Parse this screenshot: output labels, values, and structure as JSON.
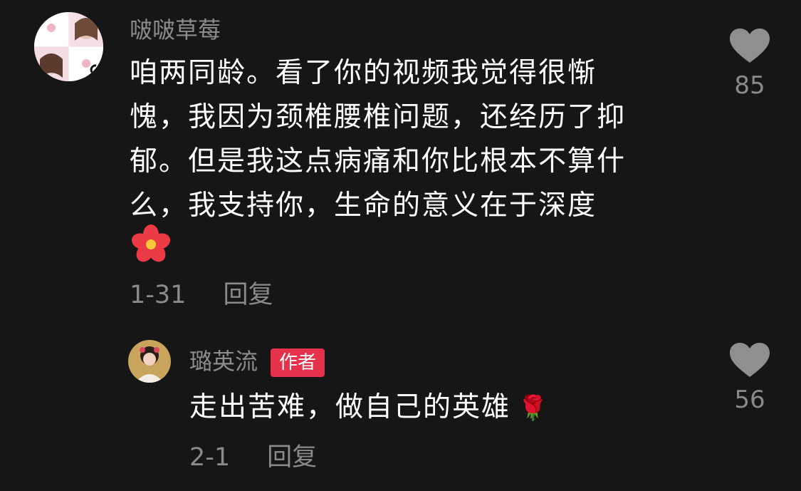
{
  "comment": {
    "username": "啵啵草莓",
    "text_lines": [
      "咱两同龄。看了你的视频我觉得很惭",
      "愧，我因为颈椎腰椎问题，还经历了抑",
      "郁。但是我这点病痛和你比根本不算什",
      "么，我支持你，生命的意义在于深度"
    ],
    "emoji": "🌸",
    "date": "1-31",
    "reply_label": "回复",
    "like_count": "85"
  },
  "reply": {
    "username": "璐英流",
    "badge": "作者",
    "text": "走出苦难，做自己的英雄",
    "emoji": "🌹",
    "date": "2-1",
    "reply_label": "回复",
    "like_count": "56"
  },
  "colors": {
    "background": "#161616",
    "secondary_text": "#8a8a8a",
    "badge": "#e6314a"
  }
}
